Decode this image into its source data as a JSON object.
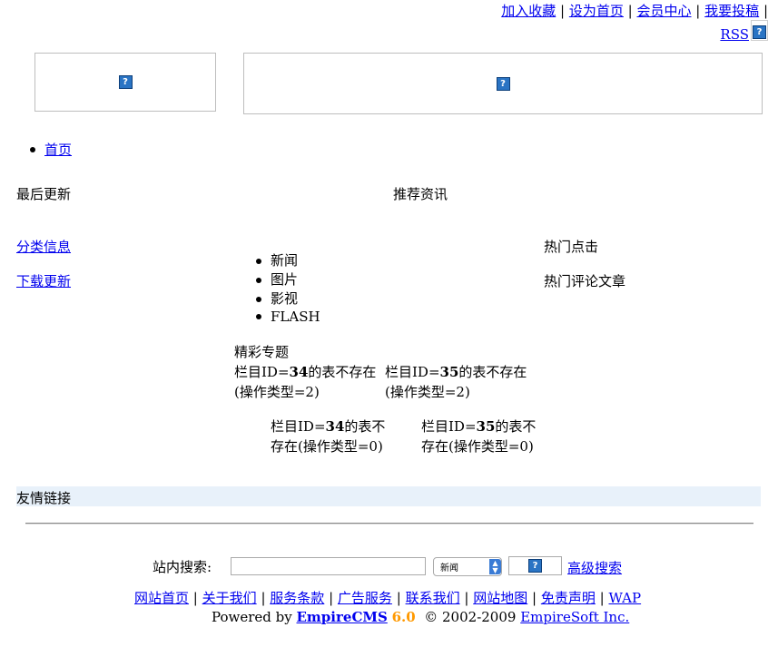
{
  "top_links": [
    "加入收藏",
    "设为首页",
    "会员中心",
    "我要投稿"
  ],
  "separator": "|",
  "rss_label": "RSS",
  "broken_image_glyph": "?",
  "nav": {
    "home": "首页"
  },
  "sections": {
    "latest": "最后更新",
    "recommended": "推荐资讯",
    "classified": "分类信息",
    "downloads": "下载更新",
    "hot_clicks": "热门点击",
    "hot_comments": "热门评论文章"
  },
  "categories": [
    "新闻",
    "图片",
    "影视",
    "FLASH"
  ],
  "special": {
    "title": "精彩专题",
    "err1": {
      "prefix": "栏目ID=",
      "id": "34",
      "suffix": "的表不存在",
      "op": "(操作类型=2)"
    },
    "err2": {
      "prefix": "栏目ID=",
      "id": "35",
      "suffix": "的表不存在",
      "op": "(操作类型=2)"
    },
    "err3": {
      "prefix": "栏目ID=",
      "id": "34",
      "suffix": "的表不",
      "line2": "存在(操作类型=0)"
    },
    "err4": {
      "prefix": "栏目ID=",
      "id": "35",
      "suffix": "的表不",
      "line2": "存在(操作类型=0)"
    }
  },
  "friends_title": "友情链接",
  "search": {
    "label": "站内搜索:",
    "input_value": "",
    "select_value": "新闻",
    "advanced_link": "高级搜索"
  },
  "footer_links": [
    "网站首页",
    "关于我们",
    "服务条款",
    "广告服务",
    "联系我们",
    "网站地图",
    "免责声明",
    "WAP"
  ],
  "powered": {
    "prefix": "Powered by ",
    "brand": "EmpireCMS",
    "version": "6.0",
    "copyright": "© 2002-2009",
    "company": "EmpireSoft Inc."
  },
  "colors": {
    "link": "#0000ee",
    "version": "#ff9900",
    "friend_bar": "#e8f1fa"
  }
}
